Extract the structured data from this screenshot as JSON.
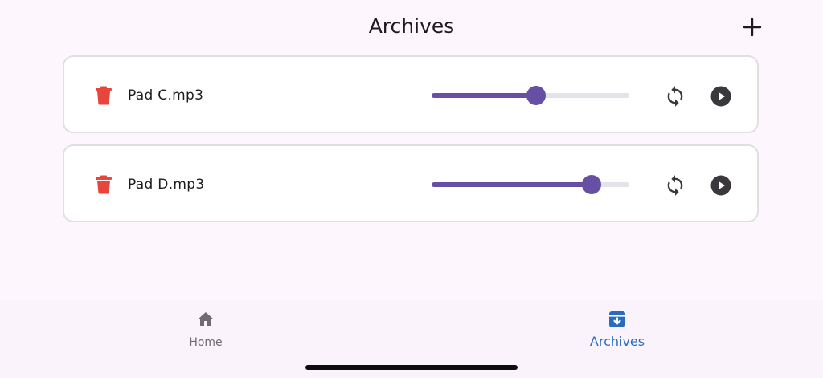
{
  "header": {
    "title": "Archives",
    "add_icon": "plus-icon"
  },
  "tracks": [
    {
      "name": "Pad C.mp3",
      "volume_fraction": 0.53,
      "delete_icon": "trash-icon",
      "loop_icon": "repeat-icon",
      "play_icon": "play-circle-icon"
    },
    {
      "name": "Pad D.mp3",
      "volume_fraction": 0.81,
      "delete_icon": "trash-icon",
      "loop_icon": "repeat-icon",
      "play_icon": "play-circle-icon"
    }
  ],
  "bottom_nav": {
    "items": [
      {
        "label": "Home",
        "icon": "home-icon",
        "active": false
      },
      {
        "label": "Archives",
        "icon": "archive-icon",
        "active": true
      }
    ]
  },
  "colors": {
    "accent": "#6750a4",
    "delete": "#e8453c",
    "active_nav": "#2a6bbf",
    "background": "#fdf7fd"
  }
}
